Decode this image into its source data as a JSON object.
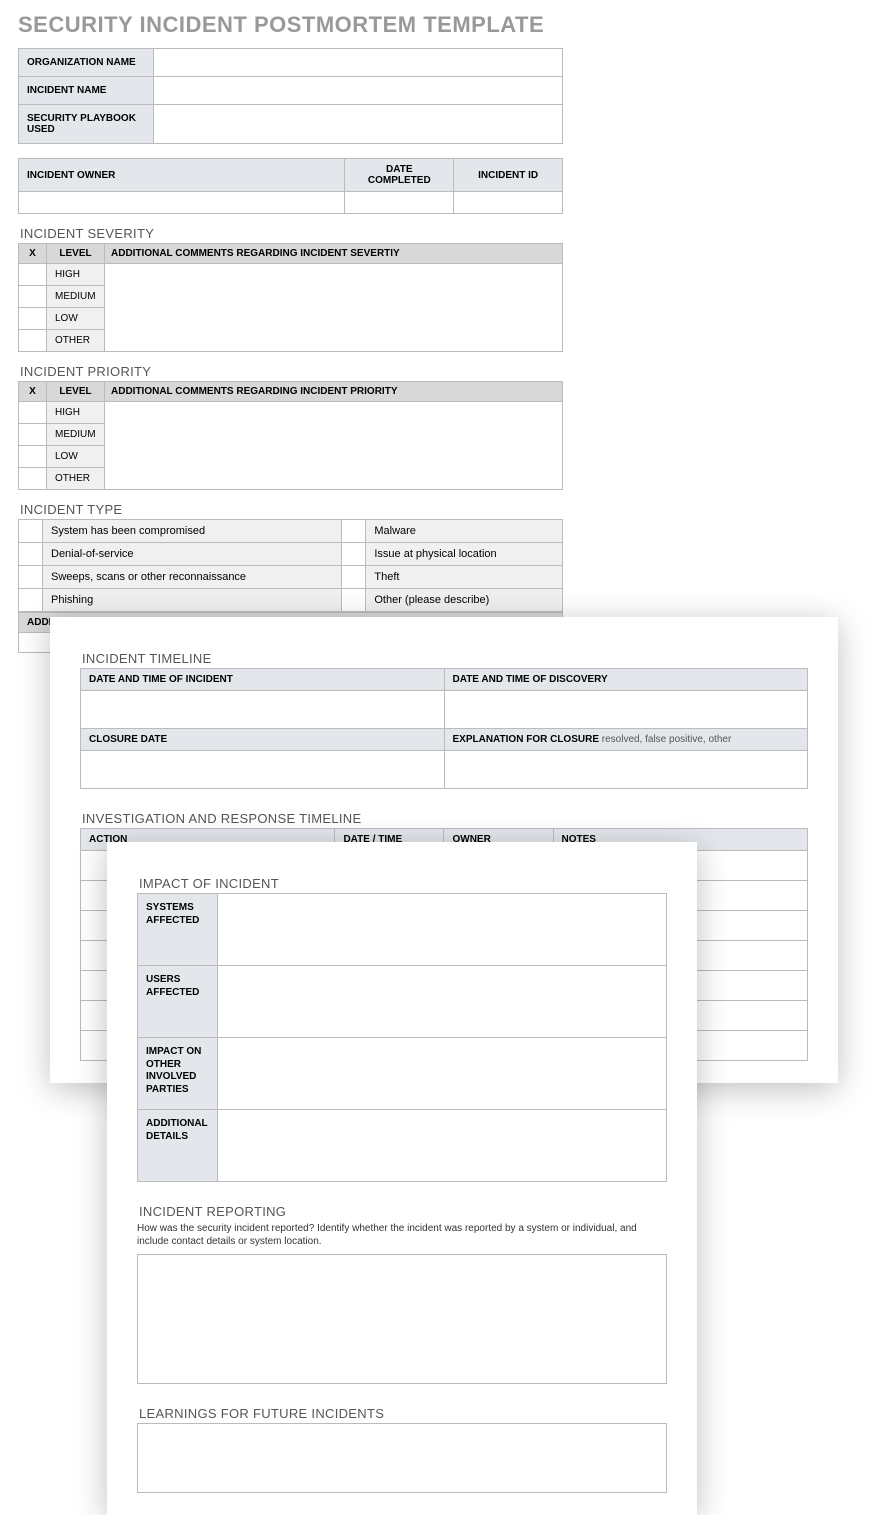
{
  "title": "SECURITY INCIDENT POSTMORTEM TEMPLATE",
  "header": {
    "org_label": "ORGANIZATION NAME",
    "org_value": "",
    "incident_label": "INCIDENT NAME",
    "incident_value": "",
    "playbook_label": "SECURITY PLAYBOOK USED",
    "playbook_value": ""
  },
  "owner": {
    "owner_label": "INCIDENT OWNER",
    "date_label": "DATE COMPLETED",
    "id_label": "INCIDENT ID",
    "owner_value": "",
    "date_value": "",
    "id_value": ""
  },
  "severity": {
    "title": "INCIDENT SEVERITY",
    "x_header": "X",
    "level_header": "LEVEL",
    "comments_header": "ADDITIONAL COMMENTS REGARDING INCIDENT SEVERTIY",
    "levels": [
      "HIGH",
      "MEDIUM",
      "LOW",
      "OTHER"
    ]
  },
  "priority": {
    "title": "INCIDENT PRIORITY",
    "x_header": "X",
    "level_header": "LEVEL",
    "comments_header": "ADDITIONAL COMMENTS REGARDING INCIDENT PRIORITY",
    "levels": [
      "HIGH",
      "MEDIUM",
      "LOW",
      "OTHER"
    ]
  },
  "type": {
    "title": "INCIDENT TYPE",
    "left": [
      "System has been compromised",
      "Denial-of-service",
      "Sweeps, scans or other reconnaissance",
      "Phishing"
    ],
    "right": [
      "Malware",
      "Issue at physical location",
      "Theft",
      "Other (please describe)"
    ],
    "foot_label": "ADDITIONAL COMMENTS / \"OTHER\" DESCRIPTION"
  },
  "timeline": {
    "title": "INCIDENT TIMELINE",
    "dt_incident": "DATE AND TIME OF INCIDENT",
    "dt_discovery": "DATE AND TIME OF DISCOVERY",
    "closure_date": "CLOSURE DATE",
    "explanation_label": "EXPLANATION FOR CLOSURE",
    "explanation_sub": "  resolved, false positive, other"
  },
  "investigation": {
    "title": "INVESTIGATION AND RESPONSE TIMELINE",
    "cols": [
      "ACTION",
      "DATE / TIME",
      "OWNER",
      "NOTES"
    ],
    "row_count": 7
  },
  "impact": {
    "title": "IMPACT OF INCIDENT",
    "rows": [
      "SYSTEMS AFFECTED",
      "USERS AFFECTED",
      "IMPACT ON OTHER INVOLVED PARTIES",
      "ADDITIONAL DETAILS"
    ]
  },
  "reporting": {
    "title": "INCIDENT REPORTING",
    "desc": "How was the security incident reported? Identify whether the incident was reported by a system or individual, and include contact details or system location."
  },
  "learnings": {
    "title": "LEARNINGS FOR FUTURE INCIDENTS"
  }
}
